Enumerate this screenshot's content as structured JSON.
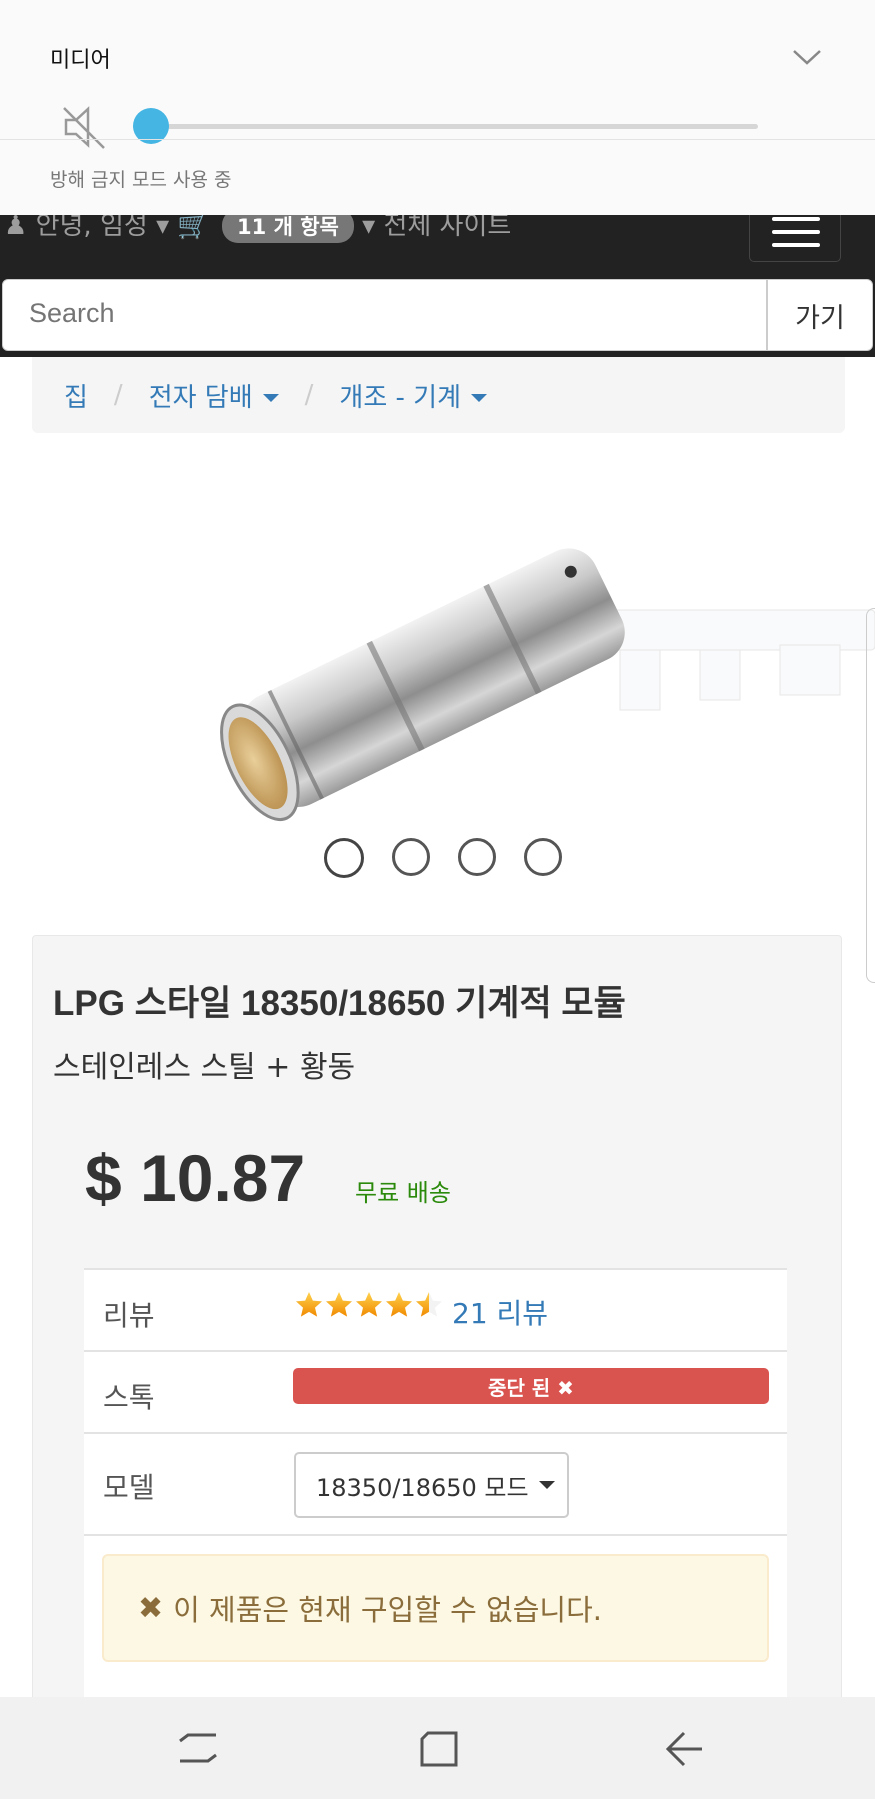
{
  "media_panel": {
    "title": "미디어",
    "dnd_label": "방해 금지 모드 사용 중",
    "volume_level": 0
  },
  "navbar": {
    "greeting": "안녕, 임성",
    "cart_count": "11 개 항목",
    "site_label": "전체 사이트",
    "search_placeholder": "Search",
    "search_button": "가기"
  },
  "breadcrumb": {
    "items": [
      "집",
      "전자 담배",
      "개조 - 기계"
    ]
  },
  "carousel": {
    "dot_count": 4,
    "active_index": 0
  },
  "product": {
    "title": "LPG 스타일 18350/18650 기계적 모듈",
    "subtitle": "스테인레스 스틸 + 황동",
    "price": "$ 10.87",
    "shipping": "무료 배송",
    "reviews_label": "리뷰",
    "rating": 4.5,
    "reviews_link": "21 리뷰",
    "stock_label": "스톡",
    "stock_status": "중단 된 ✖",
    "model_label": "모델",
    "model_value": "18350/18650 모드",
    "alert_text": "이 제품은 현재 구입할 수 없습니다."
  },
  "colors": {
    "link": "#337ab7",
    "danger": "#d9534f",
    "shipping": "#2b8a0c",
    "warning_bg": "#fcf8e3",
    "volume_accent": "#45b5e3"
  }
}
